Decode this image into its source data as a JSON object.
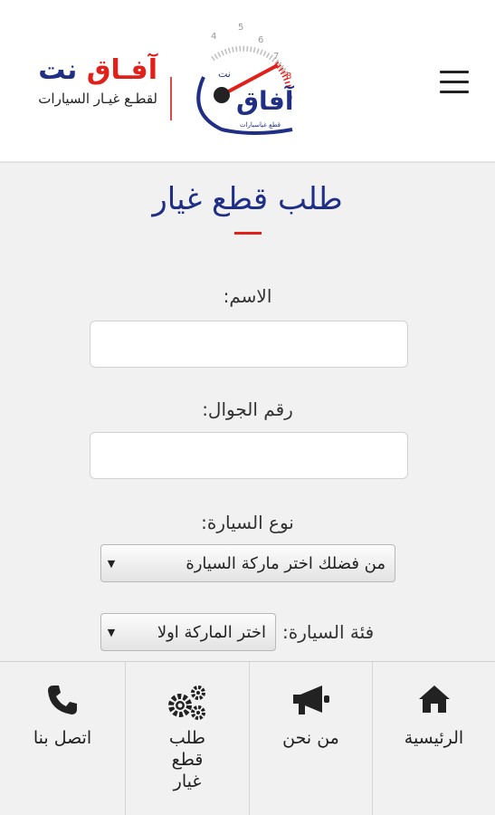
{
  "brand": {
    "name_red": "آفـاق",
    "name_blue": "نت",
    "subtitle": "لقطـع غيـار السيارات",
    "logo_text": "آفاق",
    "logo_small": "نت",
    "logo_caption": "قطع غياسيارات",
    "gauge_numbers": [
      "4",
      "5",
      "6",
      "7",
      "8",
      "9"
    ]
  },
  "page": {
    "title": "طلب قطع غيار"
  },
  "form": {
    "name_label": "الاسم:",
    "name_value": "",
    "phone_label": "رقم الجوال:",
    "phone_value": "",
    "car_type_label": "نوع السيارة:",
    "car_type_selected": "من فضلك اختر ماركة السيارة",
    "car_class_label": "فئة السيارة:",
    "car_class_selected": "اختر الماركة اولا"
  },
  "bottom_nav": {
    "items": [
      {
        "label": "الرئيسية",
        "icon": "home-icon"
      },
      {
        "label": "من نحن",
        "icon": "megaphone-icon"
      },
      {
        "label": "طلب قطع غيار",
        "icon": "gears-icon"
      },
      {
        "label": "اتصل بنا",
        "icon": "phone-icon"
      }
    ]
  },
  "colors": {
    "accent_red": "#e2201a",
    "brand_blue": "#1f2f86"
  }
}
